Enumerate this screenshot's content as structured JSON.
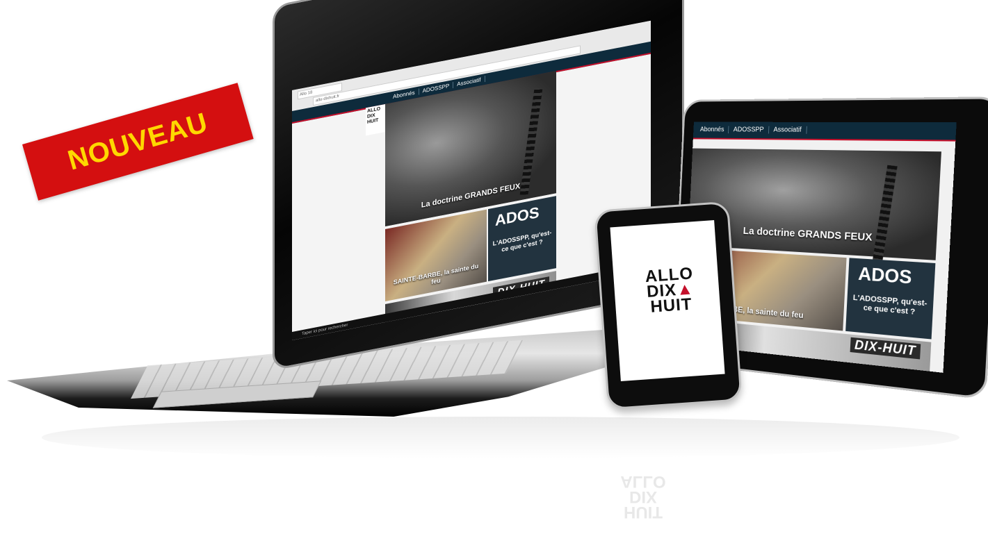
{
  "banner": {
    "label": "NOUVEAU",
    "background": "#d40f10",
    "text_color": "#ffd800"
  },
  "laptop": {
    "browser_tab": "Allo 18",
    "url": "allo-dixhuit.fr",
    "nav": [
      "Abonnés",
      "ADOSSPP",
      "Associatif"
    ],
    "logo": [
      "ALLO",
      "DIX",
      "HUIT"
    ],
    "hero_title": "La doctrine GRANDS FEUX",
    "card1_title": "SAINTE-BARBE, la sainte du feu",
    "card2_big": "ADOS",
    "card2_text": "L'ADOSSPP, qu'est-ce que c'est ?",
    "card3_sign": "DIX-HUIT",
    "taskbar_search": "Taper ici pour rechercher"
  },
  "tablet": {
    "nav": [
      "Abonnés",
      "ADOSSPP",
      "Associatif"
    ],
    "hero_title": "La doctrine GRANDS FEUX",
    "card1_title": "SAINTE-BARBE, la sainte du feu",
    "card2_big": "ADOS",
    "card2_text": "L'ADOSSPP, qu'est-ce que c'est ?",
    "card3_sign": "DIX-HUIT"
  },
  "phone": {
    "logo_line1": "ALLO",
    "logo_line2": "DIX",
    "logo_line3": "HUIT"
  },
  "colors": {
    "nav_bg": "#0e2b3c",
    "nav_accent": "#c4102b"
  }
}
